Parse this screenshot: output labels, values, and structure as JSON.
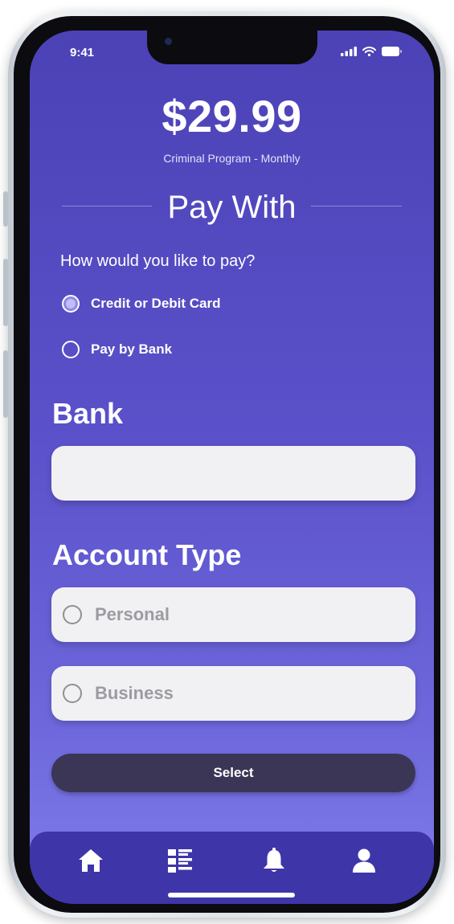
{
  "status_bar": {
    "time": "9:41",
    "icons": [
      "cellular-signal-icon",
      "wifi-icon",
      "battery-icon"
    ]
  },
  "header": {
    "price": "$29.99",
    "plan": "Criminal Program - Monthly"
  },
  "pay_with": {
    "title": "Pay With",
    "question": "How would you like to pay?",
    "options": [
      {
        "label": "Credit or Debit Card",
        "selected": true
      },
      {
        "label": "Pay by Bank",
        "selected": false
      }
    ]
  },
  "bank": {
    "label": "Bank",
    "value": ""
  },
  "account_type": {
    "label": "Account Type",
    "options": [
      {
        "label": "Personal",
        "selected": false
      },
      {
        "label": "Business",
        "selected": false
      }
    ]
  },
  "select_button": {
    "label": "Select"
  },
  "tab_bar": {
    "items": [
      "home-icon",
      "list-icon",
      "bell-icon",
      "profile-icon"
    ]
  },
  "colors": {
    "background_top": "#4c42b6",
    "background_bottom": "#7a76e6",
    "tab_bar": "#3e35a8",
    "button": "#3b3656",
    "card": "#f1f1f3"
  }
}
